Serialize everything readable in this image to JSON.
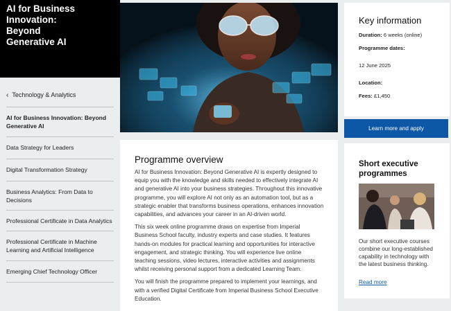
{
  "hero": {
    "title_lines": [
      "AI for Business",
      "Innovation:",
      "Beyond",
      "Generative AI"
    ]
  },
  "sidenav": {
    "back_label": "Technology & Analytics",
    "items": [
      {
        "label": "AI for Business Innovation: Beyond Generative AI",
        "active": true
      },
      {
        "label": "Data Strategy for Leaders",
        "active": false
      },
      {
        "label": "Digital Transformation Strategy",
        "active": false
      },
      {
        "label": "Business Analytics: From Data to Decisions",
        "active": false
      },
      {
        "label": "Professional Certificate in Data Analytics",
        "active": false
      },
      {
        "label": "Professional Certificate in Machine Learning and Artificial Intelligence",
        "active": false
      },
      {
        "label": "Emerging Chief Technology Officer",
        "active": false
      }
    ]
  },
  "overview": {
    "heading": "Programme overview",
    "paragraphs": [
      "AI for Business Innovation: Beyond Generative AI is expertly designed to equip you with the knowledge and skills needed to effectively integrate AI and generative AI into your business strategies. Throughout this innovative programme, you will explore AI not only as an automation tool, but as a strategic enabler that transforms business operations, enhances innovation capabilities, and advances your career in an AI-driven world.",
      "This six week online programme draws on expertise from Imperial Business School faculty, industry experts and case studies. It features hands-on modules for practical learning and opportunities for interactive engagement, and strategic thinking. You will experience live online teaching sessions, video lectures, interactive activities and assignments whilst receiving personal support from a dedicated Learning Team.",
      "You will finish the programme prepared to implement your learnings, and with a verified Digital Certificate from Imperial Business School Executive Education."
    ]
  },
  "key_info": {
    "heading": "Key information",
    "duration_label": "Duration:",
    "duration_value": "6 weeks (online)",
    "dates_label": "Programme dates:",
    "date_value": "12 June 2025",
    "location_label": "Location:",
    "fees_label": "Fees:",
    "fees_value": "£1,450",
    "apply_label": "Learn more and apply"
  },
  "short_exec": {
    "heading": "Short executive programmes",
    "text": "Our short executive courses combine our long-established capability in technology with the latest business thinking.",
    "link_label": "Read more"
  },
  "colors": {
    "accent_blue": "#0d57a7",
    "hero_black": "#000000",
    "page_bg": "#ebeeee"
  }
}
